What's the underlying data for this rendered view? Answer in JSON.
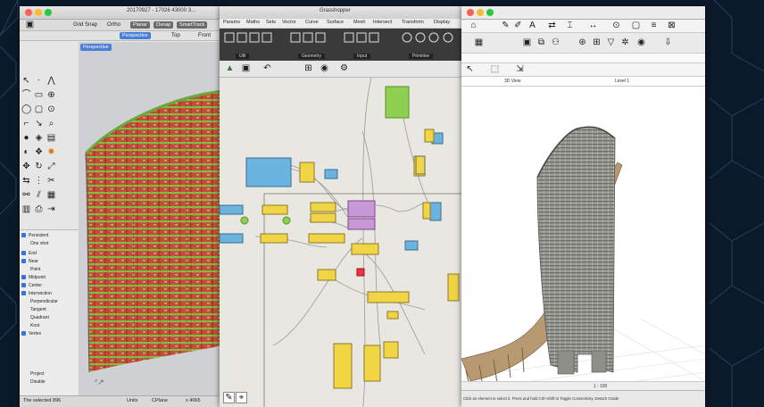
{
  "rhino": {
    "title": "20170927 - 17026 43000 3...",
    "toolbar_tabs": [
      "Grid Snap",
      "Ortho",
      "Planar",
      "Osnap",
      "SmartTrack"
    ],
    "viewport_tabs": [
      "Perspective",
      "Top",
      "Front"
    ],
    "viewport_label": "Perspective",
    "osnap": {
      "header": "Persistent",
      "items": [
        "One shot",
        "End",
        "Near",
        "Point",
        "Midpoint",
        "Center",
        "Intersection",
        "Perpendicular",
        "Tangent",
        "Quadrant",
        "Knot",
        "Vertex",
        "Project",
        "Disable"
      ]
    },
    "status": {
      "command": "The selected 896",
      "units": "Units",
      "cplane": "CPlane",
      "x": "x 4065"
    }
  },
  "grasshopper": {
    "title": "Grasshopper",
    "menus": [
      "Params",
      "Maths",
      "Sets",
      "Vector",
      "Curve",
      "Surface",
      "Mesh",
      "Intersect",
      "Transform",
      "Display"
    ],
    "ribbon_groups": [
      "Util",
      "Geometry",
      "Input",
      "Primitive"
    ]
  },
  "revit": {
    "view_tabs": [
      "3D View",
      "Level 1"
    ],
    "status": "Click an element to select it. Press and hold Ctrl+Shift to Toggle Connectivity. Detach Grade",
    "viewbar_scale": "1 : 100"
  },
  "colors": {
    "background": "#0b1a2a",
    "rhino_red": "#c0392b",
    "rhino_green": "#7bc043",
    "gh_yellow": "#f2d544",
    "gh_blue": "#6bb4e0",
    "gh_purple": "#c998d6",
    "gh_green": "#8ed04f"
  }
}
